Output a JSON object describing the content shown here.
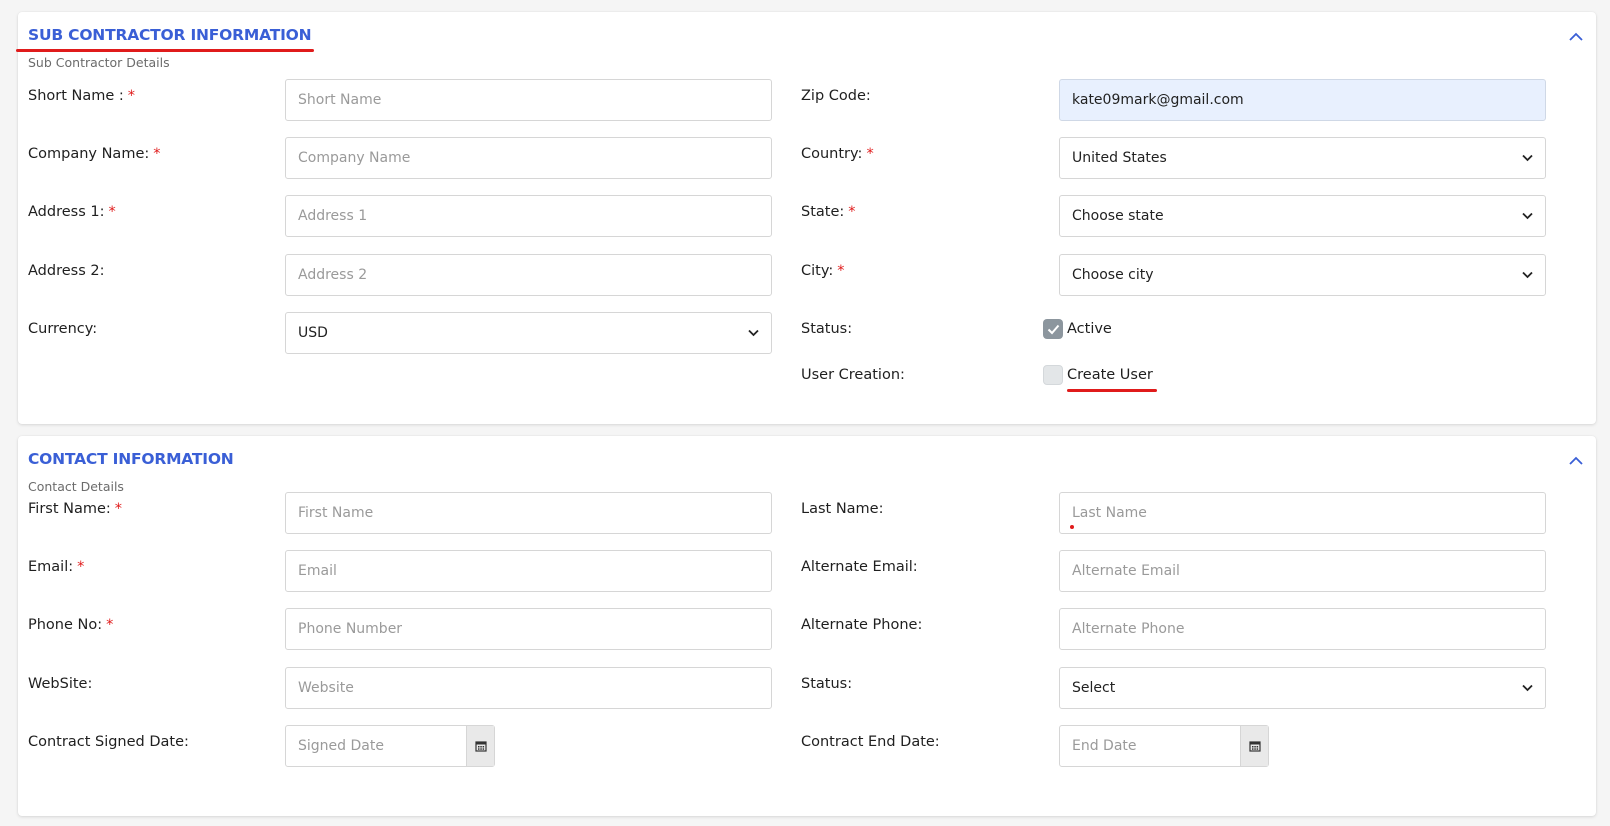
{
  "sub_contractor": {
    "title": "SUB CONTRACTOR INFORMATION",
    "subtitle": "Sub Contractor Details",
    "fields": {
      "short_name": {
        "label": "Short Name :",
        "required": "*",
        "placeholder": "Short Name"
      },
      "company_name": {
        "label": "Company Name:",
        "required": "*",
        "placeholder": "Company Name"
      },
      "address1": {
        "label": "Address 1:",
        "required": "*",
        "placeholder": "Address 1"
      },
      "address2": {
        "label": "Address 2:",
        "placeholder": "Address 2"
      },
      "currency": {
        "label": "Currency:",
        "value": "USD"
      },
      "zip_code": {
        "label": "Zip Code:",
        "value": "kate09mark@gmail.com"
      },
      "country": {
        "label": "Country:",
        "required": "*",
        "value": "United States"
      },
      "state": {
        "label": "State:",
        "required": "*",
        "value": "Choose state"
      },
      "city": {
        "label": "City:",
        "required": "*",
        "value": "Choose city"
      },
      "status": {
        "label": "Status:",
        "checkbox_label": "Active",
        "checked": true
      },
      "user_creation": {
        "label": "User Creation:",
        "checkbox_label": "Create User",
        "checked": false
      }
    }
  },
  "contact": {
    "title": "CONTACT INFORMATION",
    "subtitle": "Contact Details",
    "fields": {
      "first_name": {
        "label": "First Name:",
        "required": "*",
        "placeholder": "First Name"
      },
      "email": {
        "label": "Email:",
        "required": "*",
        "placeholder": "Email"
      },
      "phone": {
        "label": "Phone No:",
        "required": "*",
        "placeholder": "Phone Number"
      },
      "website": {
        "label": "WebSite:",
        "placeholder": "Website"
      },
      "signed_date": {
        "label": "Contract Signed Date:",
        "placeholder": "Signed Date"
      },
      "last_name": {
        "label": "Last Name:",
        "placeholder": "Last Name"
      },
      "alt_email": {
        "label": "Alternate Email:",
        "placeholder": "Alternate Email"
      },
      "alt_phone": {
        "label": "Alternate Phone:",
        "placeholder": "Alternate Phone"
      },
      "status": {
        "label": "Status:",
        "value": "Select"
      },
      "end_date": {
        "label": "Contract End Date:",
        "placeholder": "End Date"
      }
    }
  },
  "icons": {
    "collapse": "chevron-up-icon",
    "dropdown": "chevron-down-icon",
    "calendar": "calendar-icon",
    "check": "check-icon"
  },
  "colors": {
    "title": "#3a5fd6",
    "required": "#e01b1b",
    "autofill_bg": "#e8f0fe",
    "checkbox_on": "#8c969e"
  }
}
